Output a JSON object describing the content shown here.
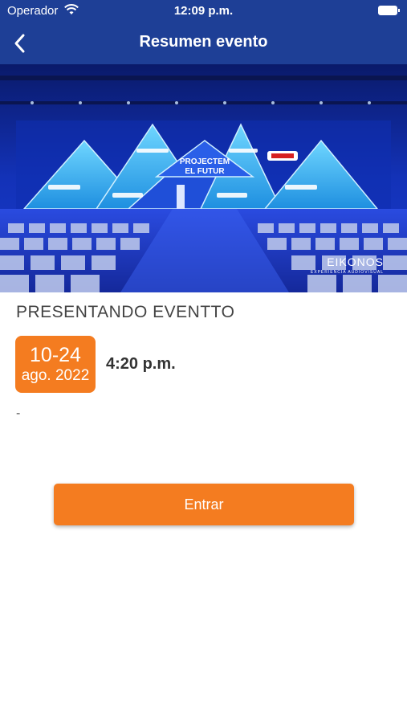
{
  "status_bar": {
    "carrier": "Operador",
    "time": "12:09 p.m."
  },
  "nav": {
    "title": "Resumen evento",
    "back_icon": "chevron-left-icon"
  },
  "hero": {
    "stage_title_line1": "PROJECTEM",
    "stage_title_line2": "EL FUTUR",
    "brand": "EIKONOS",
    "brand_tagline": "EXPERIENCIA AUDIOVISUAL"
  },
  "event": {
    "name": "PRESENTANDO EVENTTO",
    "date_days": "10-24",
    "date_month": "ago. 2022",
    "time": "4:20 p.m.",
    "description": "-"
  },
  "actions": {
    "enter_label": "Entrar"
  },
  "colors": {
    "header": "#1e3f96",
    "accent": "#f47c20"
  }
}
